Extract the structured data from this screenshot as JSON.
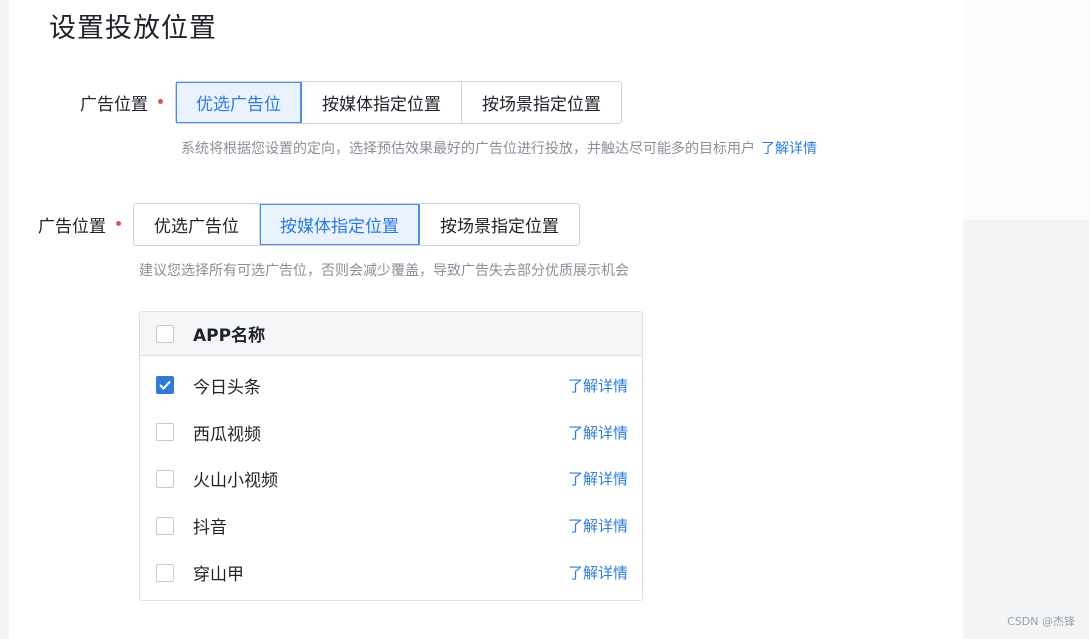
{
  "page": {
    "title": "设置投放位置"
  },
  "section1": {
    "label": "广告位置",
    "options": [
      "优选广告位",
      "按媒体指定位置",
      "按场景指定位置"
    ],
    "selected": "优选广告位",
    "hint": "系统将根据您设置的定向，选择预估效果最好的广告位进行投放，并触达尽可能多的目标用户",
    "hint_link": "了解详情"
  },
  "section2": {
    "label": "广告位置",
    "options": [
      "优选广告位",
      "按媒体指定位置",
      "按场景指定位置"
    ],
    "selected": "按媒体指定位置",
    "hint": "建议您选择所有可选广告位，否则会减少覆盖，导致广告失去部分优质展示机会"
  },
  "app_table": {
    "header": "APP名称",
    "rows": [
      {
        "name": "今日头条",
        "link": "了解详情",
        "checked": true
      },
      {
        "name": "西瓜视频",
        "link": "了解详情",
        "checked": false
      },
      {
        "name": "火山小视频",
        "link": "了解详情",
        "checked": false
      },
      {
        "name": "抖音",
        "link": "了解详情",
        "checked": false
      },
      {
        "name": "穿山甲",
        "link": "了解详情",
        "checked": false
      }
    ]
  },
  "watermark": "CSDN @杰锋",
  "colors": {
    "accent": "#2f7bd6",
    "required": "#e0524f",
    "hint": "#8a8f99"
  }
}
